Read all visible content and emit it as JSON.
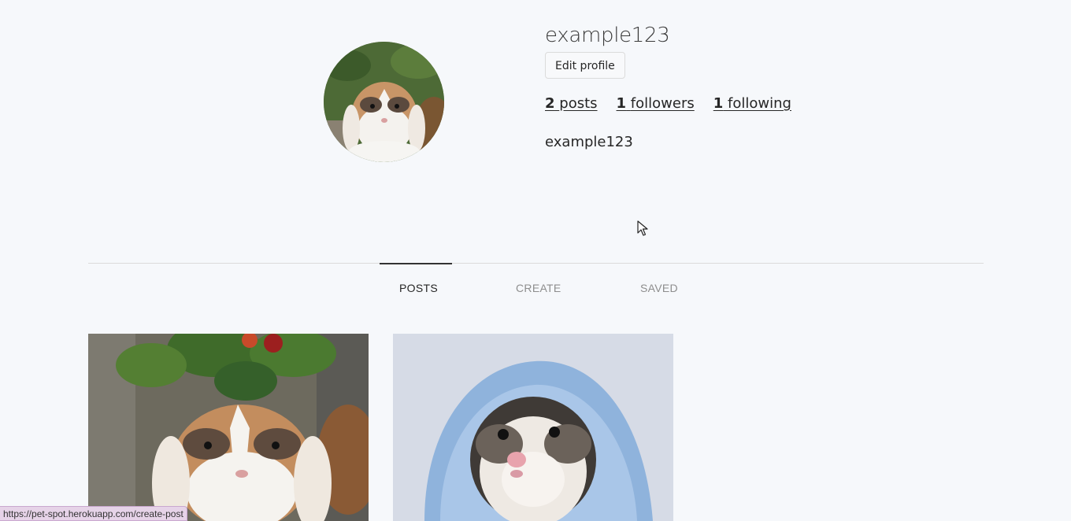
{
  "profile": {
    "username": "example123",
    "edit_label": "Edit profile",
    "stats": {
      "posts_count": "2",
      "posts_label": "posts",
      "followers_count": "1",
      "followers_label": "followers",
      "following_count": "1",
      "following_label": "following"
    },
    "full_name": "example123"
  },
  "tabs": [
    {
      "label": "POSTS",
      "active": true
    },
    {
      "label": "CREATE",
      "active": false
    },
    {
      "label": "SAVED",
      "active": false
    }
  ],
  "posts": [
    {
      "subject": "rabbit"
    },
    {
      "subject": "hamster"
    }
  ],
  "status_bar": {
    "url": "https://pet-spot.herokuapp.com/create-post"
  }
}
